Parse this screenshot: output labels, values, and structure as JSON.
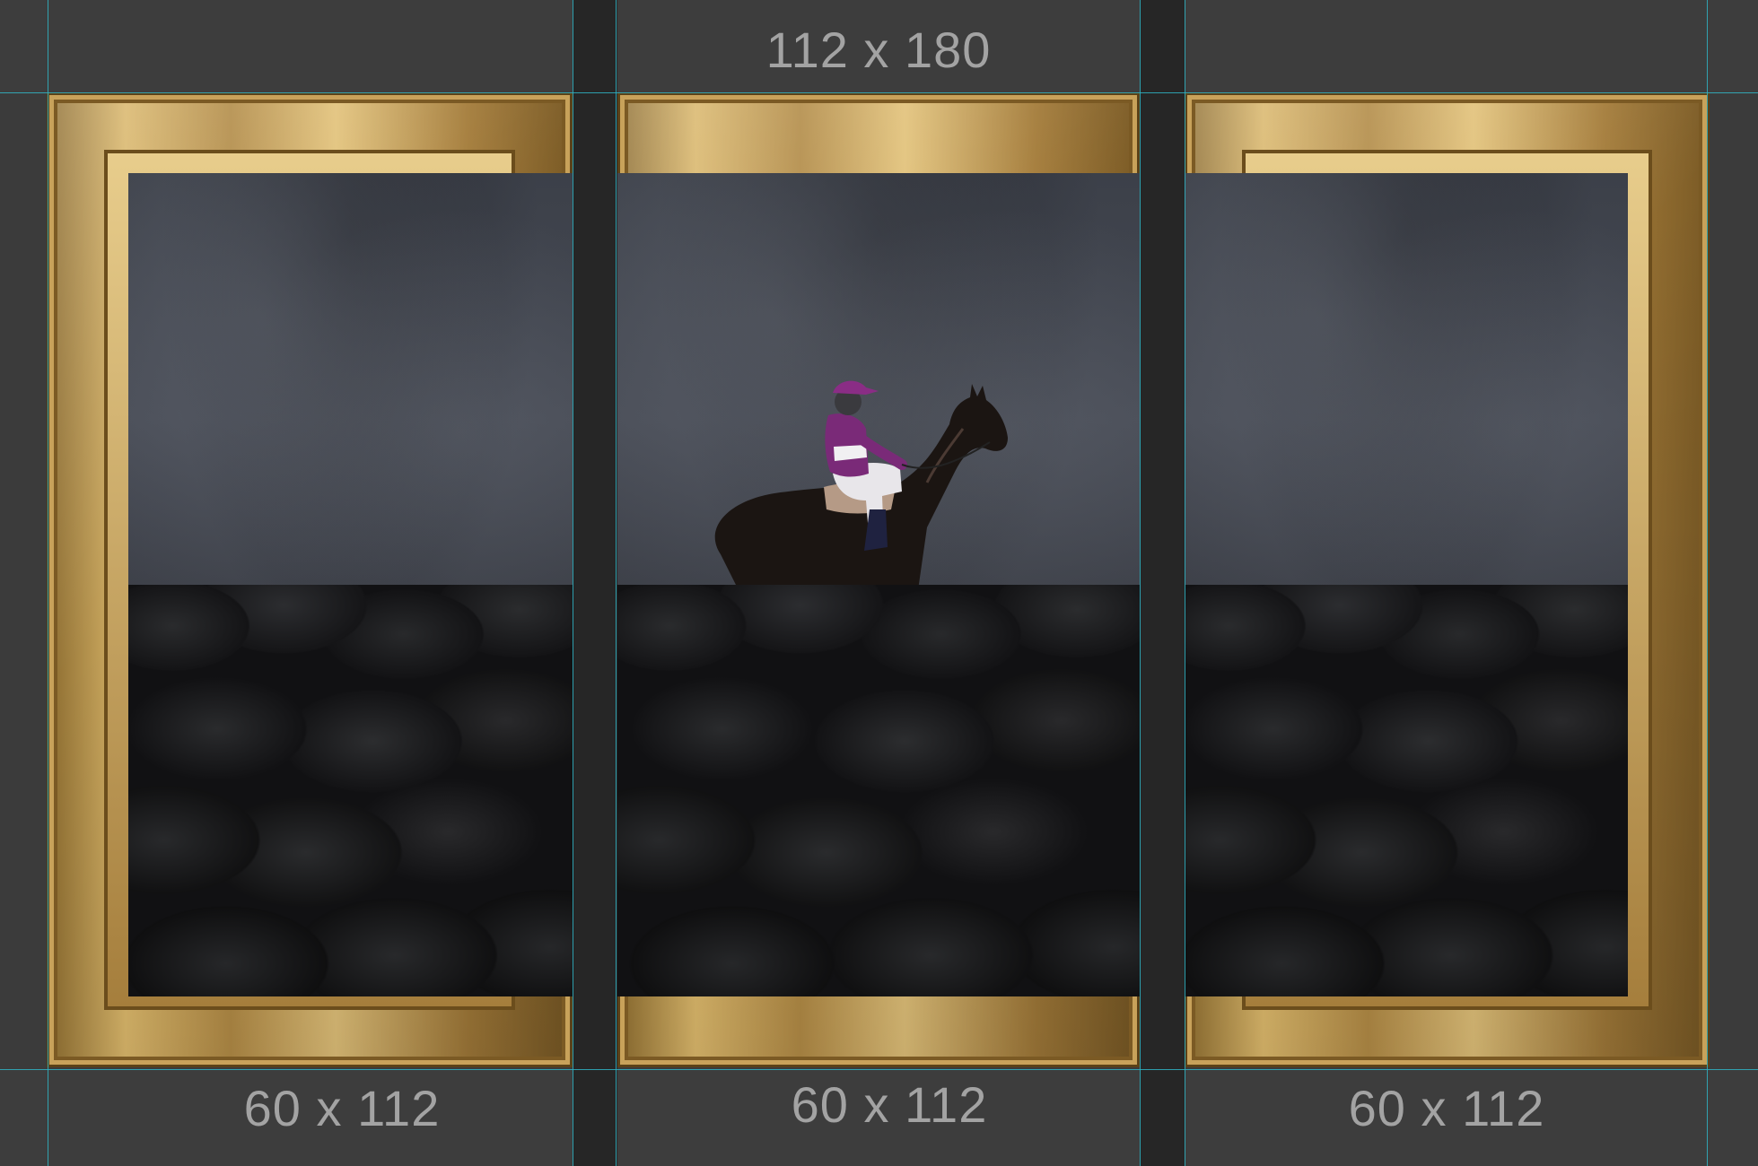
{
  "canvas": {
    "background": "#3b3b3b",
    "guide_color": "#2fb4c4",
    "frame_color": "#c8a25a"
  },
  "labels": {
    "center_top": "112 x 180",
    "left_bottom": "60 x 112",
    "center_bottom": "60 x 112",
    "right_bottom": "60 x 112"
  },
  "panels": [
    {
      "name": "left",
      "subject": "umbrellas-under-storm-sky"
    },
    {
      "name": "center",
      "subject": "jockey-on-horse-above-umbrellas"
    },
    {
      "name": "right",
      "subject": "umbrellas-under-storm-sky"
    }
  ]
}
